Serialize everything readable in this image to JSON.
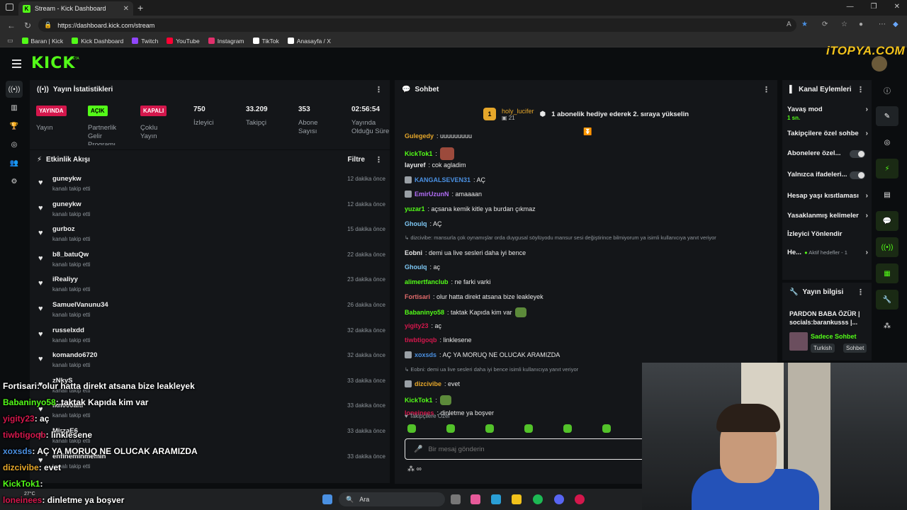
{
  "browser": {
    "tab_title": "Stream - Kick Dashboard",
    "url": "https://dashboard.kick.com/stream",
    "bookmarks": [
      {
        "label": "Baran | Kick",
        "color": "#53fc18"
      },
      {
        "label": "Kick Dashboard",
        "color": "#53fc18"
      },
      {
        "label": "Twitch",
        "color": "#9146ff"
      },
      {
        "label": "YouTube",
        "color": "#ff0033"
      },
      {
        "label": "Instagram",
        "color": "#e1306c"
      },
      {
        "label": "TikTok",
        "color": "#ffffff"
      },
      {
        "label": "Anasayfa / X",
        "color": "#ffffff"
      }
    ]
  },
  "header": {
    "logo": "KICK",
    "beta": "BETA"
  },
  "watermark": "iTOPYA.COM",
  "stats": {
    "title": "Yayın İstatistikleri",
    "items": [
      {
        "badge": "YAYINDA",
        "label": "Yayın"
      },
      {
        "badge": "AÇIK",
        "label": "Partnerlik Gelir Programı"
      },
      {
        "badge": "KAPALI",
        "label": "Çoklu Yayın"
      },
      {
        "value": "750",
        "label": "İzleyici"
      },
      {
        "value": "33.209",
        "label": "Takipçi"
      },
      {
        "value": "353",
        "label": "Abone Sayısı"
      },
      {
        "value": "02:56:54",
        "label": "Yayında Olduğu Süre"
      }
    ]
  },
  "events": {
    "title": "Etkinlik Akışı",
    "filter": "Filtre",
    "sub": "kanalı takip etti",
    "items": [
      {
        "name": "guneykw",
        "time": "12 dakika önce"
      },
      {
        "name": "guneykw",
        "time": "12 dakika önce"
      },
      {
        "name": "gurboz",
        "time": "15 dakika önce"
      },
      {
        "name": "b8_batuQw",
        "time": "22 dakika önce"
      },
      {
        "name": "iRealiyy",
        "time": "23 dakika önce"
      },
      {
        "name": "SamuelVanunu34",
        "time": "26 dakika önce"
      },
      {
        "name": "russelxdd",
        "time": "32 dakika önce"
      },
      {
        "name": "komando6720",
        "time": "32 dakika önce"
      },
      {
        "name": "zNkyS",
        "time": "33 dakika önce"
      },
      {
        "name": "ikn000alti",
        "time": "33 dakika önce"
      },
      {
        "name": "MirzaE6",
        "time": "33 dakika önce"
      },
      {
        "name": "enfineminmemin",
        "time": "33 dakika önce"
      }
    ]
  },
  "chat": {
    "title": "Sohbet",
    "pinned": {
      "rank": "1",
      "user": "holy_lucifer",
      "count": "21",
      "text": "1 abonelik hediye ederek 2. sıraya yükselin"
    },
    "messages": [
      {
        "user": "Gulegedy",
        "color": "#e6a72a",
        "text": ": uuuuuuuuu",
        "type": "msg"
      },
      {
        "user": "KickTok1",
        "color": "#53fc18",
        "text": ":",
        "type": "emote"
      },
      {
        "user": "layuref",
        "color": "#e8e8e8",
        "text": ": cok agladim",
        "type": "msg"
      },
      {
        "user": "KANGALSEVEN31",
        "color": "#4a90e2",
        "text": ": AÇ",
        "type": "badge"
      },
      {
        "user": "EmirUzunN",
        "color": "#b06cf5",
        "text": ": amaaaan",
        "type": "badge"
      },
      {
        "user": "yuzar1",
        "color": "#53fc18",
        "text": ": açsana kemik kitle ya burdan çıkmaz",
        "type": "msg"
      },
      {
        "user": "Ghoulq",
        "color": "#7ec8f5",
        "text": ": AÇ",
        "type": "msg"
      },
      {
        "reply": "↳ dizcivibe: mansurla çok oynamışlar orda duygusal söylüyodu mansur sesi değiştirince bilmiyorum ya isimli kullanıcıya yanıt veriyor",
        "type": "reply"
      },
      {
        "user": "Eobni",
        "color": "#e8e8e8",
        "text": ": demi ua live sesleri daha iyi bence",
        "type": "msg"
      },
      {
        "user": "Ghoulq",
        "color": "#7ec8f5",
        "text": ": aç",
        "type": "msg"
      },
      {
        "user": "alimertfanclub",
        "color": "#53fc18",
        "text": ": ne farki varki",
        "type": "msg"
      },
      {
        "user": "Fortisari",
        "color": "#e26b6b",
        "text": ": olur hatta direkt atsana bize leakleyek",
        "type": "msg"
      },
      {
        "user": "Babaninyo58",
        "color": "#53fc18",
        "text": ": taktak Kapıda kim var",
        "type": "emote-end"
      },
      {
        "user": "yigity23",
        "color": "#d4174c",
        "text": ": aç",
        "type": "msg"
      },
      {
        "user": "tiwbtigoqb",
        "color": "#d4174c",
        "text": ": linklesene",
        "type": "msg"
      },
      {
        "user": "xoxsds",
        "color": "#4a90e2",
        "text": ": AÇ YA MORUQ NE OLUCAK ARAMIZDA",
        "type": "badge"
      },
      {
        "reply": "↳ Eobni: demi ua live sesleri daha iyi bence isimli kullanıcıya yanıt veriyor",
        "type": "reply"
      },
      {
        "user": "dizcivibe",
        "color": "#e6a72a",
        "text": ": evet",
        "type": "badge"
      },
      {
        "user": "KickTok1",
        "color": "#53fc18",
        "text": ":",
        "type": "emote"
      },
      {
        "user": "loneinees",
        "color": "#d4174c",
        "text": ": dinletme ya boşver",
        "type": "msg"
      }
    ],
    "follower_only": "♥ Takipçilere Özel",
    "input_placeholder": "Bir mesaj gönderin",
    "footer": "∞"
  },
  "actions": {
    "title": "Kanal Eylemleri",
    "items": [
      {
        "label": "Yavaş mod",
        "sub": "1 sn.",
        "kind": "arrow"
      },
      {
        "label": "Takipçilere özel sohbe",
        "kind": "arrow"
      },
      {
        "label": "Abonelere özel...",
        "kind": "toggle"
      },
      {
        "label": "Yalnızca ifadeleri...",
        "kind": "toggle"
      },
      {
        "label": "Hesap yaşı kısıtlaması",
        "kind": "arrow"
      },
      {
        "label": "Yasaklanmış kelimeler",
        "kind": "arrow"
      },
      {
        "label": "İzleyici Yönlendir",
        "kind": "none"
      },
      {
        "label": "He...",
        "sub": "Aktif hedefler - 1",
        "kind": "arrow"
      }
    ]
  },
  "info": {
    "title": "Yayın bilgisi",
    "stream_title": "PARDON BABA ÖZÜR | socials:barankusss |...",
    "category": "Sadece Sohbet",
    "tags": [
      "Turkish",
      "Sohbet"
    ]
  },
  "overlay": [
    {
      "user": "Fortisari",
      "color": "#ffffff",
      "text": ": olur hatta direkt atsana bize leakleyek"
    },
    {
      "user": "Babaninyo58",
      "color": "#53fc18",
      "text": ": taktak Kapıda kim var"
    },
    {
      "user": "yigity23",
      "color": "#d4174c",
      "text": ": aç"
    },
    {
      "user": "tiwbtigoqb",
      "color": "#d4174c",
      "text": ": linklesene"
    },
    {
      "user": "xoxsds",
      "color": "#4a90e2",
      "text": ": AÇ YA MORUQ NE OLUCAK ARAMIZDA"
    },
    {
      "user": "dizcivibe",
      "color": "#e6a72a",
      "text": ": evet"
    },
    {
      "user": "KickTok1",
      "color": "#53fc18",
      "text": ":"
    },
    {
      "user": "loneinees",
      "color": "#d4174c",
      "text": ": dinletme ya boşver"
    }
  ],
  "taskbar": {
    "search": "Ara",
    "weather": "27°C"
  }
}
